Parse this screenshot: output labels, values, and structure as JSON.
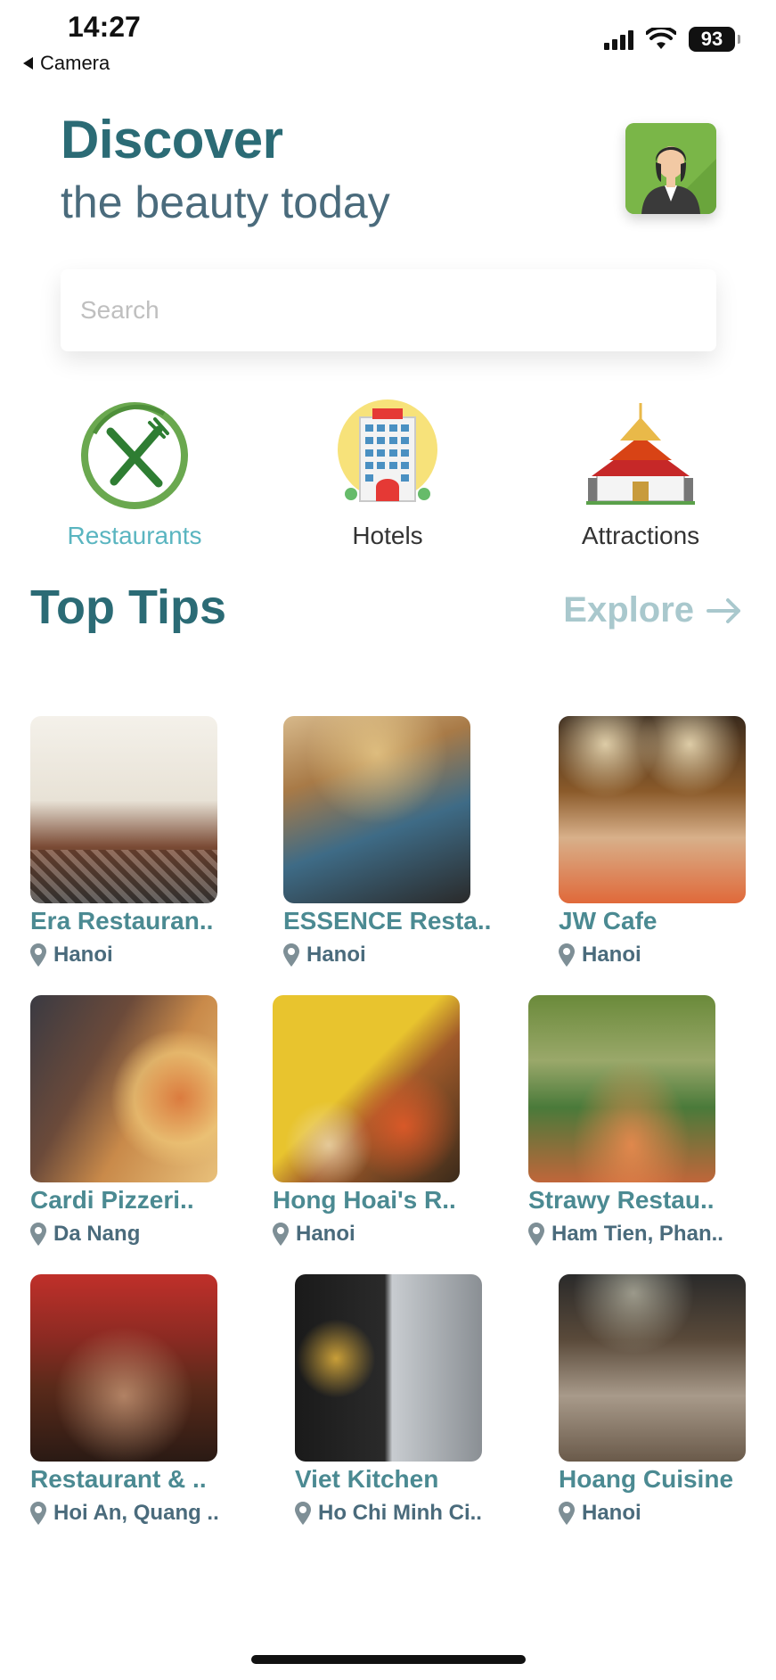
{
  "status": {
    "time": "14:27",
    "back_app": "Camera",
    "battery": "93"
  },
  "header": {
    "title": "Discover",
    "subtitle": "the beauty today"
  },
  "search": {
    "placeholder": "Search",
    "value": ""
  },
  "categories": [
    {
      "label": "Restaurants",
      "icon": "fork-knife-icon",
      "active": true
    },
    {
      "label": "Hotels",
      "icon": "hotel-icon",
      "active": false
    },
    {
      "label": "Attractions",
      "icon": "temple-icon",
      "active": false
    }
  ],
  "section": {
    "title": "Top Tips",
    "explore": "Explore"
  },
  "places": [
    {
      "name": "Era Restauran..",
      "location": "Hanoi"
    },
    {
      "name": "ESSENCE Resta..",
      "location": "Hanoi"
    },
    {
      "name": "JW Cafe",
      "location": "Hanoi"
    },
    {
      "name": "Cardi Pizzeri..",
      "location": "Da Nang"
    },
    {
      "name": "Hong Hoai's R..",
      "location": "Hanoi"
    },
    {
      "name": "Strawy Restau..",
      "location": "Ham Tien, Phan.."
    },
    {
      "name": "Restaurant & ..",
      "location": "Hoi An, Quang .."
    },
    {
      "name": "Viet Kitchen",
      "location": "Ho Chi Minh Ci.."
    },
    {
      "name": "Hoang Cuisine",
      "location": "Hanoi"
    }
  ],
  "colors": {
    "primary": "#2b6b75",
    "accent": "#5ab5c0",
    "muted": "#a9c8cd",
    "card_text": "#4b8a92"
  }
}
